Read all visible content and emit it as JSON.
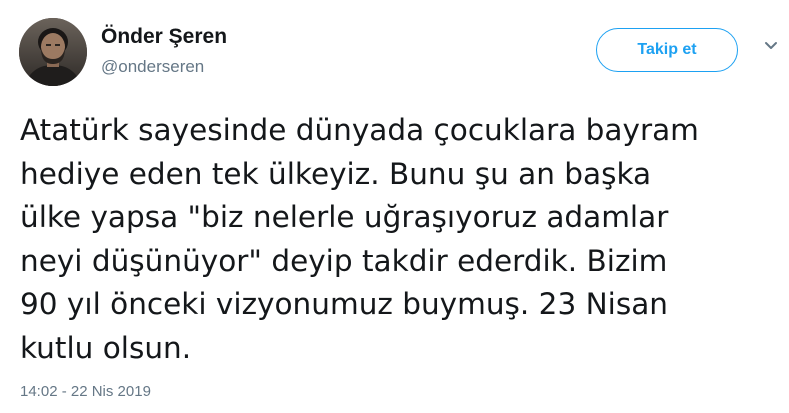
{
  "author": {
    "name": "Önder Şeren",
    "handle": "@onderseren",
    "avatar_icon": "user-avatar-photo"
  },
  "follow_button": {
    "label": "Takip et"
  },
  "menu": {
    "icon": "chevron-down-icon"
  },
  "tweet": {
    "lines": [
      "Atatürk sayesinde dünyada çocuklara bayram",
      "hediye eden tek ülkeyiz. Bunu şu an başka",
      "ülke yapsa \"biz nelerle uğraşıyoruz adamlar",
      "neyi düşünüyor\" deyip takdir ederdik. Bizim",
      "90 yıl önceki vizyonumuz buymuş. 23 Nisan",
      "kutlu olsun."
    ],
    "timestamp": "14:02 - 22 Nis 2019"
  },
  "colors": {
    "accent": "#1da1f2",
    "text": "#14171a",
    "secondary": "#657786"
  }
}
